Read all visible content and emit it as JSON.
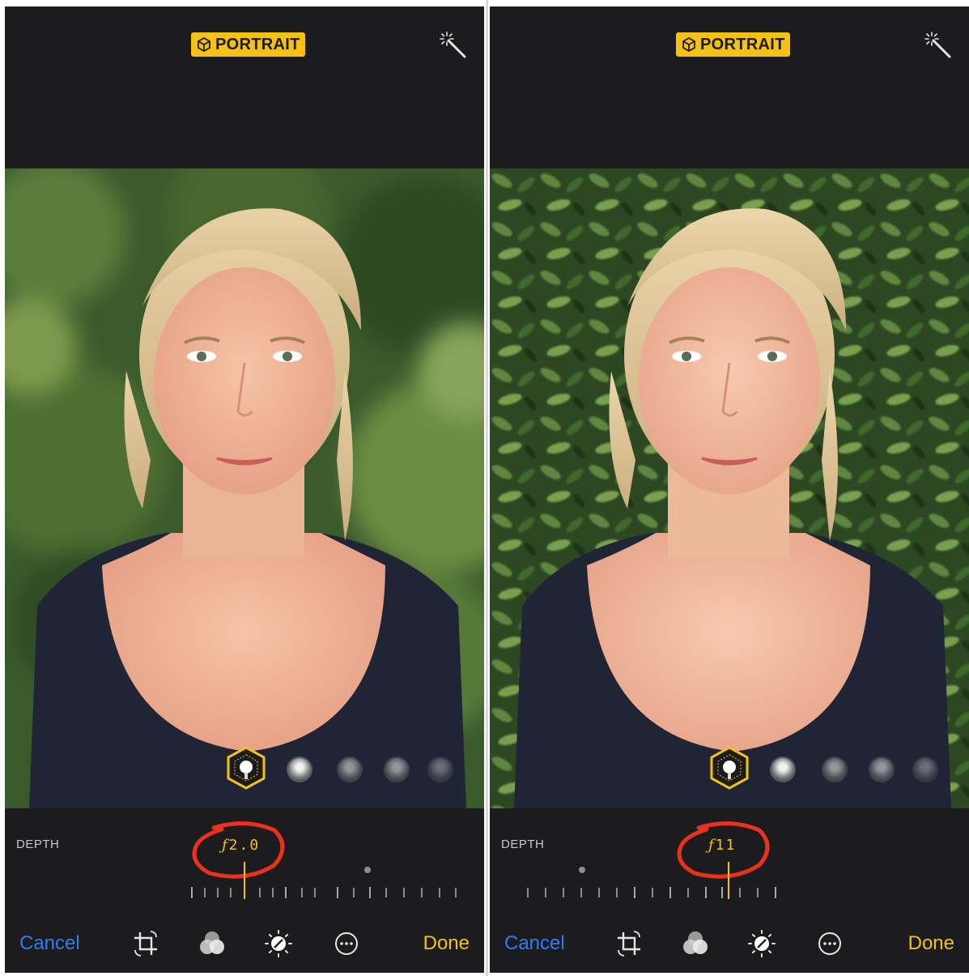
{
  "panels": [
    {
      "id": "left",
      "mode_badge": "PORTRAIT",
      "depth_label": "DEPTH",
      "f_prefix": "ƒ",
      "f_value": "2.0",
      "cancel_label": "Cancel",
      "done_label": "Done",
      "background": "blurred"
    },
    {
      "id": "right",
      "mode_badge": "PORTRAIT",
      "depth_label": "DEPTH",
      "f_prefix": "ƒ",
      "f_value": "11",
      "cancel_label": "Cancel",
      "done_label": "Done",
      "background": "sharp"
    }
  ],
  "icons": {
    "badge": "cube-icon",
    "auto_enhance": "magic-wand-icon",
    "crop": "crop-rotate-icon",
    "filters": "filters-icon",
    "adjust": "adjust-dial-icon",
    "more": "more-ellipsis-icon",
    "lighting": "portrait-lighting-icon"
  },
  "colors": {
    "accent_yellow": "#f5c116",
    "cancel_blue": "#2f7df6",
    "annotation_red": "#e8321e",
    "bar_background": "#1c1c1e"
  }
}
